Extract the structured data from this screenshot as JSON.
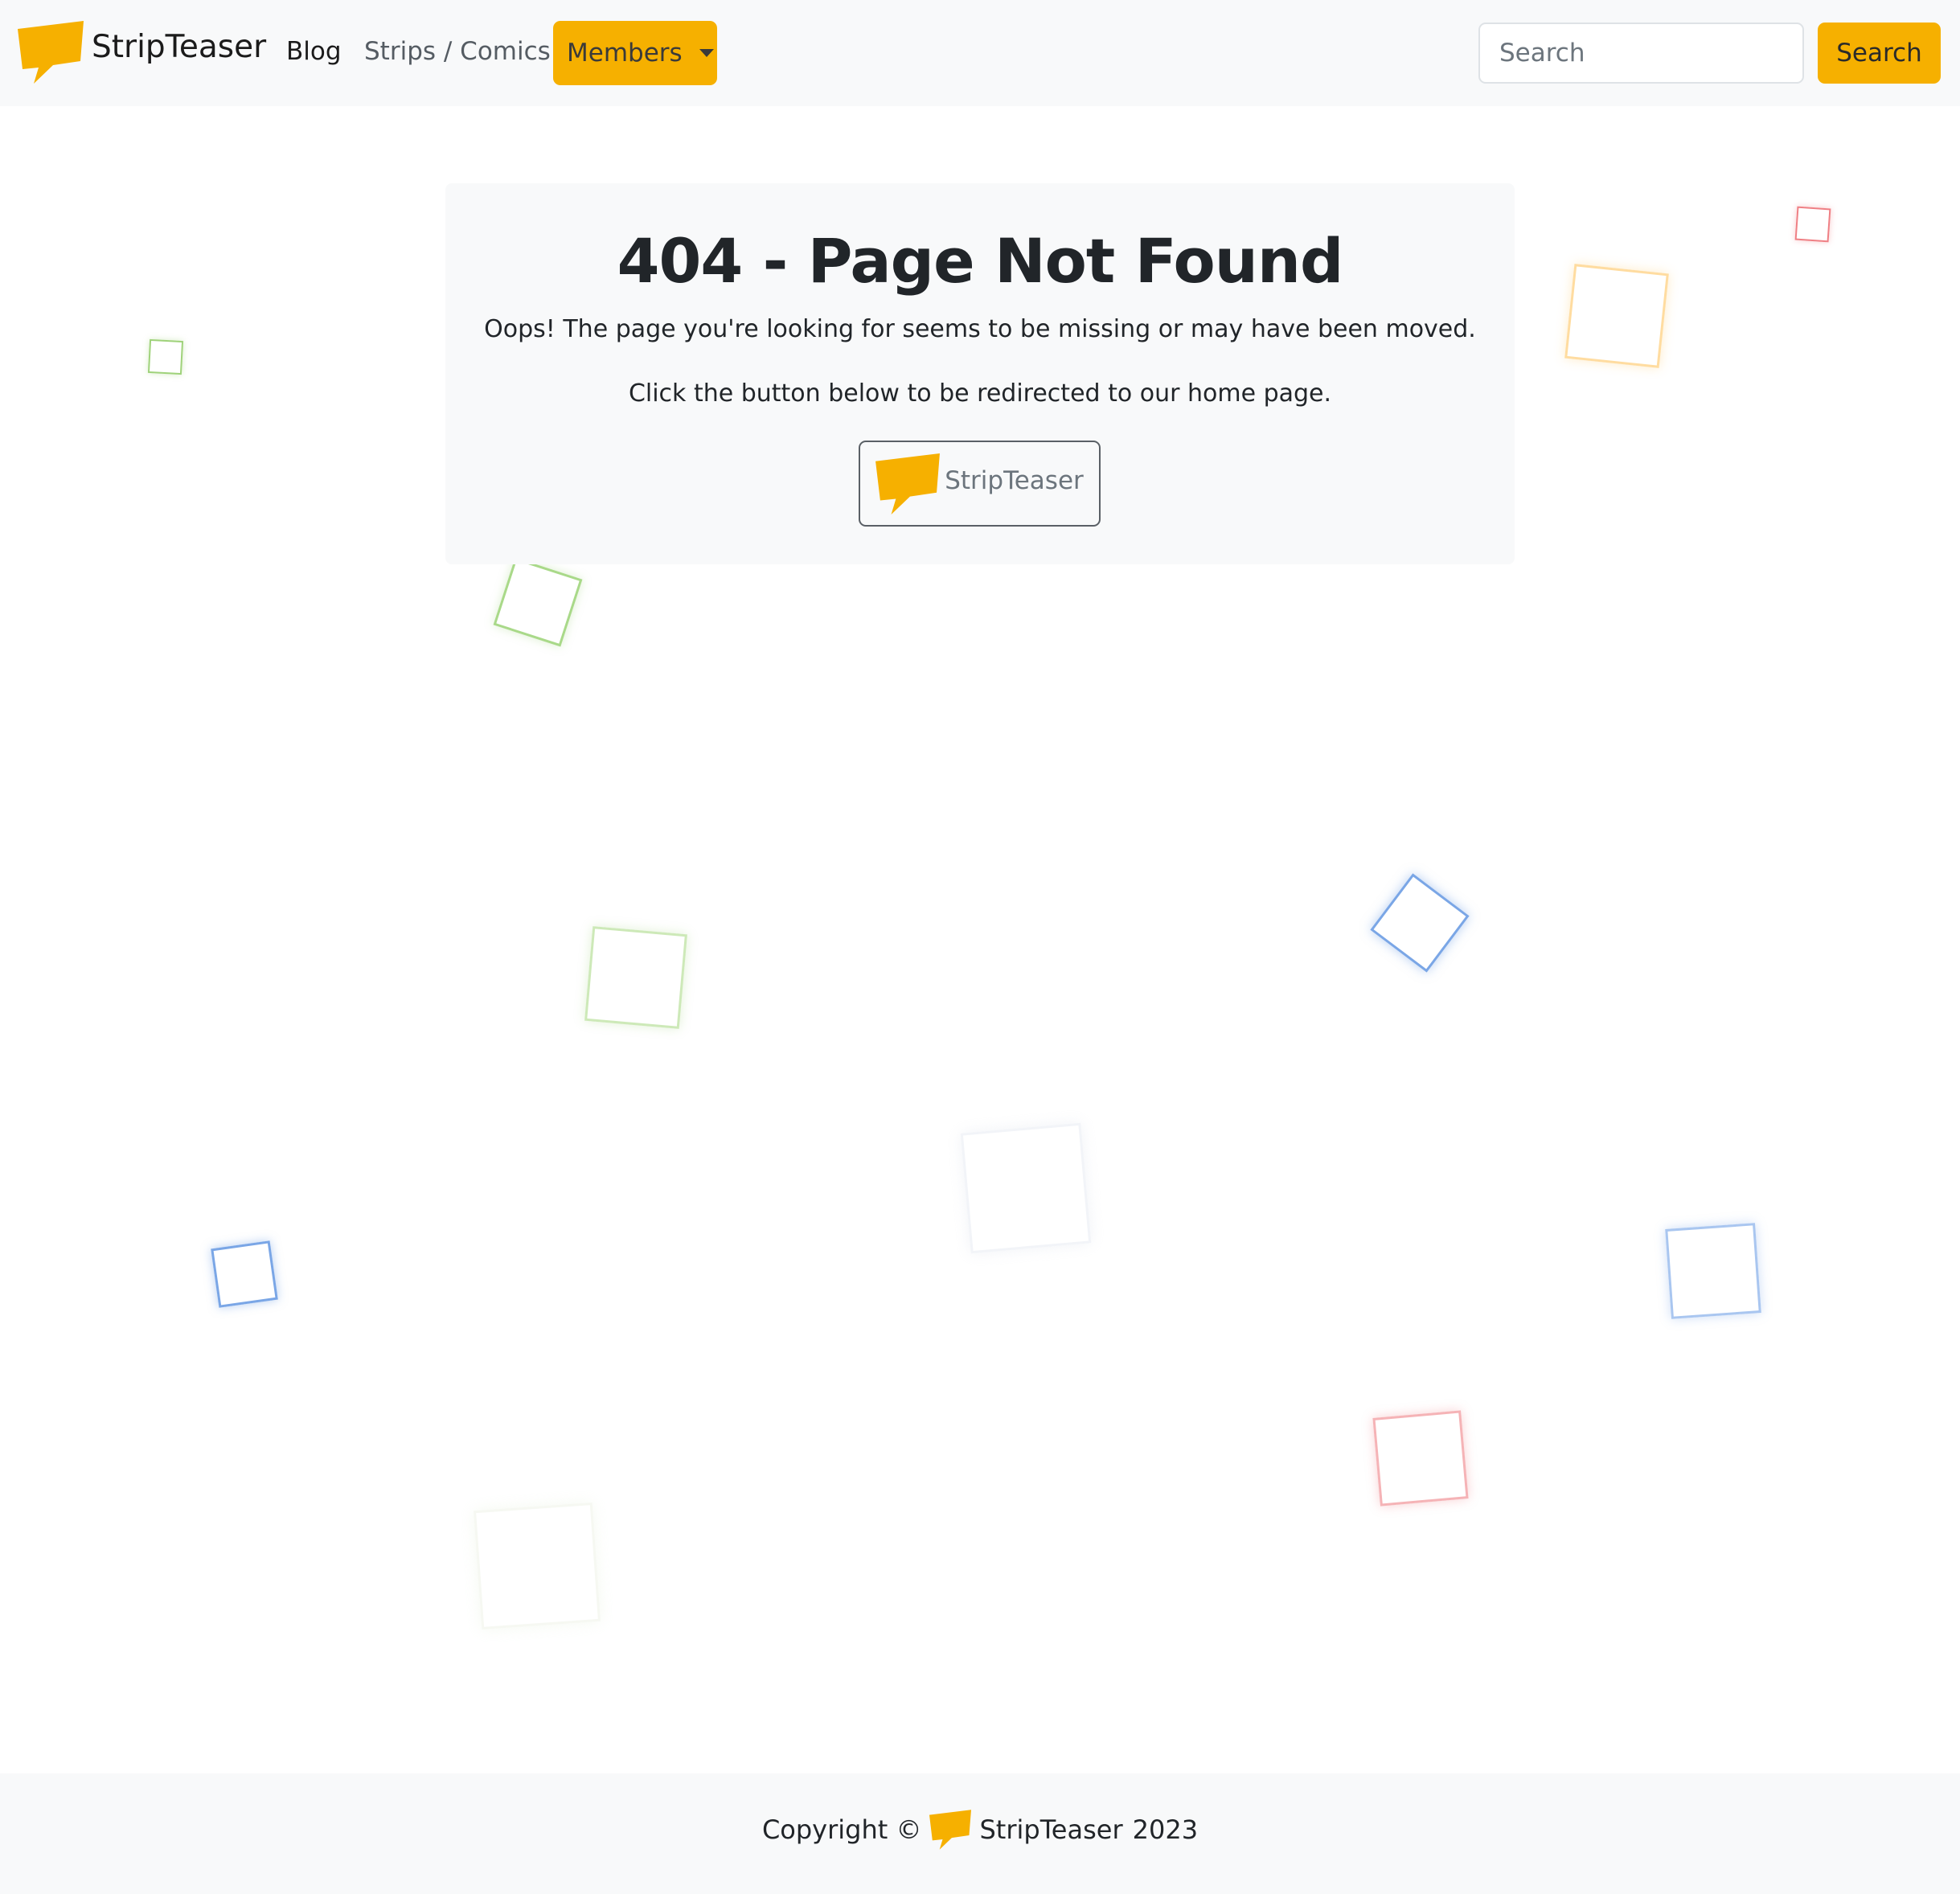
{
  "brand": {
    "name": "StripTeaser",
    "logo_icon": "speech-bubble-logo-icon",
    "color": "#f6b000"
  },
  "nav": {
    "blog": "Blog",
    "strips": "Strips / Comics",
    "members": "Members"
  },
  "search": {
    "placeholder": "Search",
    "button": "Search"
  },
  "error": {
    "title": "404 - Page Not Found",
    "message": "Oops! The page you're looking for seems to be missing or may have been moved.",
    "instruction": "Click the button below to be redirected to our home page.",
    "home_button": "StripTeaser"
  },
  "footer": {
    "prefix": "Copyright ©",
    "brand": "StripTeaser",
    "year": "2023"
  },
  "colors": {
    "accent": "#f6b000",
    "square_green": "#9fd27a",
    "square_red": "#ef7f84",
    "square_blue": "#6f9fe6",
    "square_orange": "#ffd58a"
  }
}
